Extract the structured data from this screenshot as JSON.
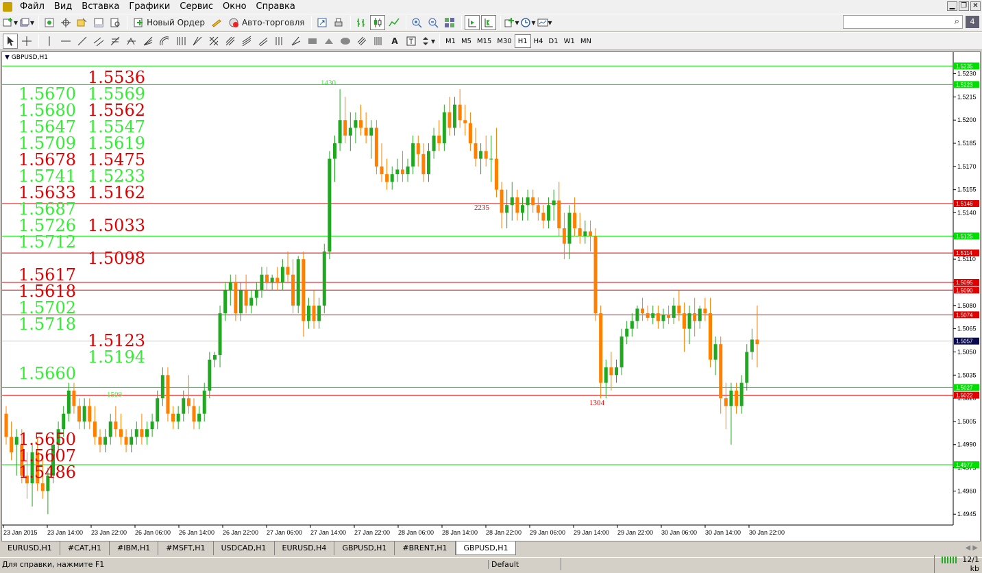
{
  "menu": [
    "Файл",
    "Вид",
    "Вставка",
    "Графики",
    "Сервис",
    "Окно",
    "Справка"
  ],
  "toolbar": {
    "new_order": "Новый Ордер",
    "autotrading": "Авто-торговля",
    "timeframes": [
      "M1",
      "M5",
      "M15",
      "M30",
      "H1",
      "H4",
      "D1",
      "W1",
      "MN"
    ],
    "active_timeframe": "H1"
  },
  "chart": {
    "title": "GBPUSD,H1",
    "symbol": "GBPUSD",
    "timeframe": "H1",
    "colors": {
      "up": "#21a821",
      "down": "#ff7f00",
      "green_level": "#00e000",
      "red_level": "#e00000",
      "text_green": "#33ee33",
      "text_red": "#e00000"
    },
    "price_axis": {
      "ticks": [
        "1.5230",
        "1.5215",
        "1.5200",
        "1.5185",
        "1.5170",
        "1.5155",
        "1.5140",
        "1.5125",
        "1.5110",
        "1.5095",
        "1.5080",
        "1.5065",
        "1.5050",
        "1.5035",
        "1.5020",
        "1.5005",
        "1.4990",
        "1.4975",
        "1.4960",
        "1.4945"
      ],
      "range": [
        1.4938,
        1.5244
      ]
    },
    "time_axis": [
      "23 Jan 2015",
      "23 Jan 14:00",
      "23 Jan 22:00",
      "26 Jan 06:00",
      "26 Jan 14:00",
      "26 Jan 22:00",
      "27 Jan 06:00",
      "27 Jan 14:00",
      "27 Jan 22:00",
      "28 Jan 06:00",
      "28 Jan 14:00",
      "28 Jan 22:00",
      "29 Jan 06:00",
      "29 Jan 14:00",
      "29 Jan 22:00",
      "30 Jan 06:00",
      "30 Jan 14:00",
      "30 Jan 22:00"
    ],
    "levels": [
      {
        "price": "1.5235",
        "color": "green"
      },
      {
        "price": "1.5223",
        "color": "green"
      },
      {
        "price": "1.5146",
        "color": "red"
      },
      {
        "price": "1.5125",
        "color": "green"
      },
      {
        "price": "1.5114",
        "color": "red"
      },
      {
        "price": "1.5095",
        "color": "red"
      },
      {
        "price": "1.5090",
        "color": "red"
      },
      {
        "price": "1.5074",
        "color": "red"
      },
      {
        "price": "1.5027",
        "color": "green"
      },
      {
        "price": "1.5022",
        "color": "red"
      },
      {
        "price": "1.4977",
        "color": "green"
      }
    ],
    "current_price": "1.5057",
    "annotations": [
      {
        "text": "1430",
        "color": "green"
      },
      {
        "text": "2235",
        "color": "red"
      },
      {
        "text": "1509",
        "color": "green"
      },
      {
        "text": "1304",
        "color": "red"
      }
    ],
    "left_column": [
      {
        "text": "1.5670",
        "color": "green"
      },
      {
        "text": "1.5680",
        "color": "green"
      },
      {
        "text": "1.5647",
        "color": "green"
      },
      {
        "text": "1.5709",
        "color": "green"
      },
      {
        "text": "1.5678",
        "color": "red"
      },
      {
        "text": "1.5741",
        "color": "green"
      },
      {
        "text": "1.5633",
        "color": "red"
      },
      {
        "text": "1.5687",
        "color": "green"
      },
      {
        "text": "1.5726",
        "color": "green"
      },
      {
        "text": "1.5712",
        "color": "green"
      },
      {
        "text": "1.5617",
        "color": "red"
      },
      {
        "text": "1.5618",
        "color": "red"
      },
      {
        "text": "1.5702",
        "color": "green"
      },
      {
        "text": "1.5718",
        "color": "green"
      },
      {
        "text": "1.5660",
        "color": "green"
      },
      {
        "text": "1.5650",
        "color": "red"
      },
      {
        "text": "1.5607",
        "color": "red"
      },
      {
        "text": "1.5486",
        "color": "red"
      }
    ],
    "right_column": [
      {
        "text": "1.5536",
        "color": "red"
      },
      {
        "text": "1.5569",
        "color": "green"
      },
      {
        "text": "1.5562",
        "color": "red"
      },
      {
        "text": "1.5547",
        "color": "green"
      },
      {
        "text": "1.5619",
        "color": "green"
      },
      {
        "text": "1.5475",
        "color": "red"
      },
      {
        "text": "1.5233",
        "color": "green"
      },
      {
        "text": "1.5162",
        "color": "red"
      },
      {
        "text": "1.5033",
        "color": "red"
      },
      {
        "text": "1.5098",
        "color": "red"
      },
      {
        "text": "1.5123",
        "color": "red"
      },
      {
        "text": "1.5194",
        "color": "green"
      }
    ]
  },
  "chart_data": {
    "type": "candlestick",
    "symbol": "GBPUSD",
    "timeframe": "H1",
    "ohlc": [
      [
        1.501,
        1.5015,
        1.499,
        1.4995
      ],
      [
        1.4995,
        1.5005,
        1.498,
        1.4985
      ],
      [
        1.499,
        1.5,
        1.497,
        1.4995
      ],
      [
        1.499,
        1.5,
        1.4965,
        1.497
      ],
      [
        1.497,
        1.4985,
        1.4955,
        1.4965
      ],
      [
        1.4965,
        1.499,
        1.495,
        1.4985
      ],
      [
        1.4985,
        1.4995,
        1.496,
        1.4965
      ],
      [
        1.4965,
        1.498,
        1.4955,
        1.496
      ],
      [
        1.496,
        1.4975,
        1.4945,
        1.497
      ],
      [
        1.497,
        1.4995,
        1.4965,
        1.499
      ],
      [
        1.499,
        1.5005,
        1.4985,
        1.5
      ],
      [
        1.5,
        1.5015,
        1.4995,
        1.501
      ],
      [
        1.501,
        1.503,
        1.5005,
        1.5025
      ],
      [
        1.5025,
        1.503,
        1.501,
        1.5015
      ],
      [
        1.5015,
        1.502,
        1.5,
        1.5005
      ],
      [
        1.5005,
        1.502,
        1.5,
        1.5015
      ],
      [
        1.5015,
        1.502,
        1.5,
        1.5005
      ],
      [
        1.5005,
        1.5015,
        1.499,
        1.4995
      ],
      [
        1.4995,
        1.5,
        1.4985,
        1.499
      ],
      [
        1.499,
        1.5,
        1.4985,
        1.4995
      ],
      [
        1.4995,
        1.501,
        1.499,
        1.5005
      ],
      [
        1.5005,
        1.5015,
        1.4995,
        1.5
      ],
      [
        1.5,
        1.501,
        1.499,
        1.4995
      ],
      [
        1.4995,
        1.5,
        1.4985,
        1.499
      ],
      [
        1.499,
        1.5,
        1.4985,
        1.4995
      ],
      [
        1.4995,
        1.5005,
        1.499,
        1.5
      ],
      [
        1.5,
        1.501,
        1.499,
        1.4995
      ],
      [
        1.4995,
        1.5005,
        1.499,
        1.5
      ],
      [
        1.5,
        1.501,
        1.4995,
        1.5005
      ],
      [
        1.5005,
        1.5025,
        1.5,
        1.502
      ],
      [
        1.502,
        1.504,
        1.5015,
        1.5035
      ],
      [
        1.5035,
        1.504,
        1.5005,
        1.501
      ],
      [
        1.501,
        1.5015,
        1.5,
        1.5005
      ],
      [
        1.5005,
        1.5015,
        1.5,
        1.501
      ],
      [
        1.501,
        1.5025,
        1.5005,
        1.502
      ],
      [
        1.502,
        1.5035,
        1.501,
        1.5015
      ],
      [
        1.5015,
        1.502,
        1.5,
        1.5005
      ],
      [
        1.5005,
        1.5015,
        1.5,
        1.501
      ],
      [
        1.501,
        1.503,
        1.5005,
        1.5025
      ],
      [
        1.5025,
        1.505,
        1.502,
        1.5045
      ],
      [
        1.5045,
        1.505,
        1.504,
        1.5048
      ],
      [
        1.5048,
        1.508,
        1.504,
        1.5075
      ],
      [
        1.5075,
        1.5095,
        1.507,
        1.509
      ],
      [
        1.509,
        1.51,
        1.508,
        1.5095
      ],
      [
        1.5095,
        1.51,
        1.507,
        1.5075
      ],
      [
        1.5075,
        1.5095,
        1.507,
        1.509
      ],
      [
        1.509,
        1.51,
        1.5075,
        1.508
      ],
      [
        1.508,
        1.509,
        1.5075,
        1.5085
      ],
      [
        1.5085,
        1.5095,
        1.508,
        1.509
      ],
      [
        1.509,
        1.5105,
        1.5085,
        1.51
      ],
      [
        1.51,
        1.5105,
        1.509,
        1.5095
      ],
      [
        1.5095,
        1.51,
        1.509,
        1.5098
      ],
      [
        1.5098,
        1.5105,
        1.509,
        1.5095
      ],
      [
        1.5095,
        1.511,
        1.509,
        1.5105
      ],
      [
        1.5105,
        1.5115,
        1.5095,
        1.51
      ],
      [
        1.51,
        1.511,
        1.5075,
        1.508
      ],
      [
        1.508,
        1.5112,
        1.5075,
        1.511
      ],
      [
        1.511,
        1.5115,
        1.506,
        1.507
      ],
      [
        1.507,
        1.5085,
        1.5065,
        1.508
      ],
      [
        1.508,
        1.509,
        1.5065,
        1.507
      ],
      [
        1.507,
        1.5085,
        1.5065,
        1.508
      ],
      [
        1.508,
        1.512,
        1.5075,
        1.5115
      ],
      [
        1.5115,
        1.518,
        1.511,
        1.5175
      ],
      [
        1.5175,
        1.519,
        1.516,
        1.5185
      ],
      [
        1.5185,
        1.522,
        1.518,
        1.52
      ],
      [
        1.52,
        1.5215,
        1.5185,
        1.519
      ],
      [
        1.519,
        1.5205,
        1.518,
        1.5195
      ],
      [
        1.5195,
        1.5205,
        1.5185,
        1.52
      ],
      [
        1.52,
        1.521,
        1.519,
        1.5195
      ],
      [
        1.5195,
        1.5205,
        1.5185,
        1.519
      ],
      [
        1.519,
        1.52,
        1.5175,
        1.5195
      ],
      [
        1.5195,
        1.52,
        1.5165,
        1.517
      ],
      [
        1.517,
        1.5185,
        1.516,
        1.5165
      ],
      [
        1.5165,
        1.5175,
        1.5155,
        1.516
      ],
      [
        1.516,
        1.517,
        1.5155,
        1.5165
      ],
      [
        1.5165,
        1.5175,
        1.516,
        1.5168
      ],
      [
        1.5168,
        1.518,
        1.516,
        1.5165
      ],
      [
        1.5165,
        1.5175,
        1.516,
        1.517
      ],
      [
        1.517,
        1.519,
        1.5165,
        1.5185
      ],
      [
        1.5185,
        1.519,
        1.517,
        1.5178
      ],
      [
        1.5178,
        1.5185,
        1.516,
        1.5165
      ],
      [
        1.5165,
        1.5185,
        1.516,
        1.518
      ],
      [
        1.518,
        1.5195,
        1.5175,
        1.519
      ],
      [
        1.519,
        1.52,
        1.518,
        1.5185
      ],
      [
        1.5185,
        1.521,
        1.518,
        1.5205
      ],
      [
        1.5205,
        1.5215,
        1.519,
        1.5195
      ],
      [
        1.5195,
        1.5215,
        1.519,
        1.521
      ],
      [
        1.521,
        1.522,
        1.5195,
        1.52
      ],
      [
        1.52,
        1.521,
        1.519,
        1.5198
      ],
      [
        1.5198,
        1.5205,
        1.518,
        1.5185
      ],
      [
        1.5185,
        1.5195,
        1.517,
        1.5175
      ],
      [
        1.5175,
        1.5185,
        1.5165,
        1.518
      ],
      [
        1.518,
        1.519,
        1.517,
        1.5175
      ],
      [
        1.5175,
        1.519,
        1.516,
        1.5175
      ],
      [
        1.5175,
        1.5195,
        1.515,
        1.5155
      ],
      [
        1.5155,
        1.516,
        1.513,
        1.514
      ],
      [
        1.514,
        1.5155,
        1.513,
        1.5145
      ],
      [
        1.5145,
        1.516,
        1.5135,
        1.515
      ],
      [
        1.515,
        1.5155,
        1.5135,
        1.514
      ],
      [
        1.514,
        1.515,
        1.5135,
        1.5145
      ],
      [
        1.5145,
        1.5155,
        1.5135,
        1.515
      ],
      [
        1.515,
        1.5155,
        1.514,
        1.5145
      ],
      [
        1.5145,
        1.515,
        1.5135,
        1.514
      ],
      [
        1.514,
        1.5145,
        1.513,
        1.5135
      ],
      [
        1.5135,
        1.515,
        1.513,
        1.5145
      ],
      [
        1.5145,
        1.5155,
        1.5135,
        1.5148
      ],
      [
        1.5148,
        1.516,
        1.5125,
        1.513
      ],
      [
        1.513,
        1.514,
        1.511,
        1.512
      ],
      [
        1.512,
        1.5145,
        1.511,
        1.514
      ],
      [
        1.514,
        1.515,
        1.5125,
        1.513
      ],
      [
        1.513,
        1.514,
        1.512,
        1.5125
      ],
      [
        1.5125,
        1.5135,
        1.512,
        1.5128
      ],
      [
        1.5128,
        1.5135,
        1.5115,
        1.5125
      ],
      [
        1.5125,
        1.513,
        1.507,
        1.5075
      ],
      [
        1.5075,
        1.508,
        1.502,
        1.503
      ],
      [
        1.503,
        1.5045,
        1.502,
        1.504
      ],
      [
        1.504,
        1.505,
        1.5025,
        1.5035
      ],
      [
        1.5035,
        1.5045,
        1.503,
        1.504
      ],
      [
        1.504,
        1.5065,
        1.5035,
        1.506
      ],
      [
        1.506,
        1.507,
        1.5055,
        1.5065
      ],
      [
        1.5065,
        1.5075,
        1.506,
        1.507
      ],
      [
        1.507,
        1.508,
        1.5065,
        1.5078
      ],
      [
        1.5078,
        1.5085,
        1.507,
        1.5075
      ],
      [
        1.5075,
        1.508,
        1.507,
        1.5072
      ],
      [
        1.5072,
        1.508,
        1.5068,
        1.5075
      ],
      [
        1.5075,
        1.508,
        1.5065,
        1.507
      ],
      [
        1.507,
        1.5078,
        1.5065,
        1.5074
      ],
      [
        1.5074,
        1.508,
        1.5068,
        1.5072
      ],
      [
        1.5072,
        1.5085,
        1.5068,
        1.508
      ],
      [
        1.508,
        1.509,
        1.507,
        1.5075
      ],
      [
        1.5075,
        1.5082,
        1.505,
        1.5065
      ],
      [
        1.5065,
        1.508,
        1.5055,
        1.5075
      ],
      [
        1.5075,
        1.5085,
        1.506,
        1.507
      ],
      [
        1.507,
        1.508,
        1.5065,
        1.5078
      ],
      [
        1.5078,
        1.5085,
        1.507,
        1.5075
      ],
      [
        1.5075,
        1.5085,
        1.504,
        1.5045
      ],
      [
        1.5045,
        1.506,
        1.5035,
        1.5055
      ],
      [
        1.5055,
        1.506,
        1.501,
        1.502
      ],
      [
        1.502,
        1.503,
        1.5,
        1.5015
      ],
      [
        1.5015,
        1.503,
        1.499,
        1.5025
      ],
      [
        1.5025,
        1.503,
        1.501,
        1.5015
      ],
      [
        1.5015,
        1.5035,
        1.501,
        1.503
      ],
      [
        1.503,
        1.5055,
        1.5025,
        1.505
      ],
      [
        1.505,
        1.5065,
        1.5045,
        1.5058
      ],
      [
        1.5058,
        1.508,
        1.504,
        1.5055
      ]
    ]
  }
}
